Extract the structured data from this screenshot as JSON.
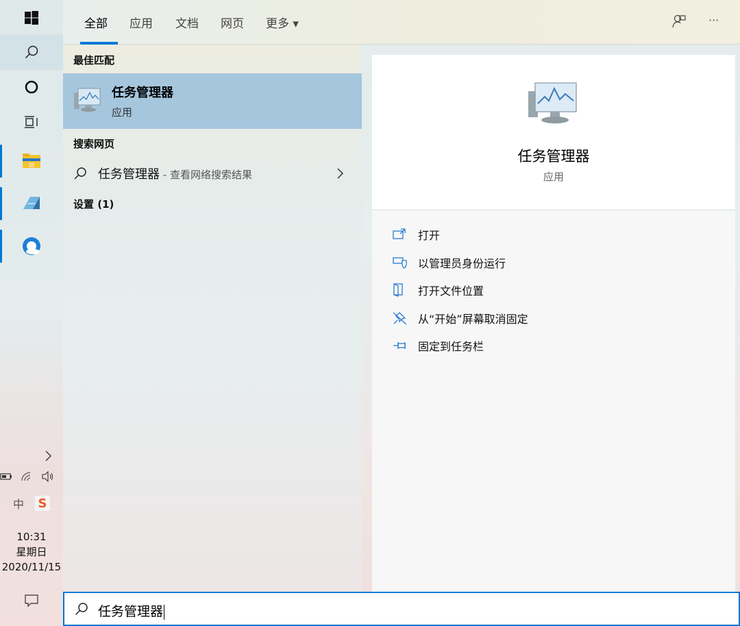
{
  "taskbar": {
    "clock_time": "10:31",
    "clock_day": "星期日",
    "clock_date": "2020/11/15",
    "ime_label": "中",
    "sogou_label": "S"
  },
  "tabs": [
    {
      "label": "全部",
      "active": true
    },
    {
      "label": "应用"
    },
    {
      "label": "文档"
    },
    {
      "label": "网页"
    },
    {
      "label": "更多 ▾"
    }
  ],
  "header": {
    "more_icon": "···"
  },
  "results": {
    "best_match_title": "最佳匹配",
    "best_match": {
      "name": "任务管理器",
      "type": "应用"
    },
    "web_title": "搜索网页",
    "web_item": {
      "name": "任务管理器",
      "suffix": " - 查看网络搜索结果"
    },
    "settings_title": "设置 (1)"
  },
  "detail": {
    "title": "任务管理器",
    "subtitle": "应用",
    "actions": [
      {
        "label": "打开",
        "icon": "open-icon"
      },
      {
        "label": "以管理员身份运行",
        "icon": "admin-shield-icon"
      },
      {
        "label": "打开文件位置",
        "icon": "file-location-icon"
      },
      {
        "label": "从“开始”屏幕取消固定",
        "icon": "unpin-icon"
      },
      {
        "label": "固定到任务栏",
        "icon": "pin-taskbar-icon"
      }
    ]
  },
  "search": {
    "value": "任务管理器"
  },
  "colors": {
    "accent": "#0078d4",
    "selected": "#a6c6de"
  }
}
